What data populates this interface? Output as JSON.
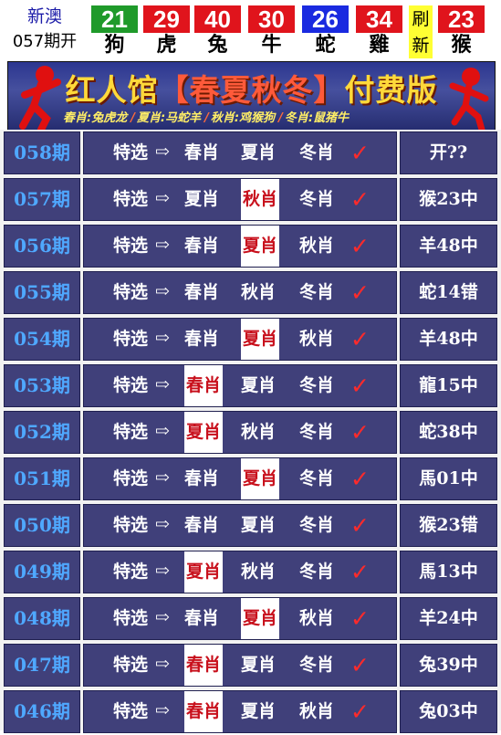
{
  "header": {
    "brand_line1": "新澳",
    "brand_line2": "057期开",
    "balls": [
      {
        "num": "21",
        "zodiac": "狗",
        "color": "#1f9a2a"
      },
      {
        "num": "29",
        "zodiac": "虎",
        "color": "#e0141c"
      },
      {
        "num": "40",
        "zodiac": "兔",
        "color": "#e0141c"
      },
      {
        "num": "30",
        "zodiac": "牛",
        "color": "#e0141c"
      },
      {
        "num": "26",
        "zodiac": "蛇",
        "color": "#1a2ae0"
      },
      {
        "num": "34",
        "zodiac": "雞",
        "color": "#e0141c"
      }
    ],
    "refresh_line1": "刷",
    "refresh_line2": "新",
    "special": {
      "num": "23",
      "zodiac": "猴",
      "color": "#e0141c"
    }
  },
  "banner": {
    "title_a": "红人馆",
    "title_b": "【春夏秋冬】",
    "title_c": "付费版",
    "seasons": [
      "春肖:兔虎龙",
      "夏肖:马蛇羊",
      "秋肖:鸡猴狗",
      "冬肖:鼠猪牛"
    ],
    "separator": "/"
  },
  "rows": [
    {
      "period": "058期",
      "prefix": "特选",
      "arrow": "⇨",
      "picks": [
        "春肖",
        "夏肖",
        "冬肖"
      ],
      "hit": -1,
      "tick": "✓",
      "result": "开??"
    },
    {
      "period": "057期",
      "prefix": "特选",
      "arrow": "⇨",
      "picks": [
        "夏肖",
        "秋肖",
        "冬肖"
      ],
      "hit": 1,
      "tick": "✓",
      "result": "猴23中"
    },
    {
      "period": "056期",
      "prefix": "特选",
      "arrow": "⇨",
      "picks": [
        "春肖",
        "夏肖",
        "秋肖"
      ],
      "hit": 1,
      "tick": "✓",
      "result": "羊48中"
    },
    {
      "period": "055期",
      "prefix": "特选",
      "arrow": "⇨",
      "picks": [
        "春肖",
        "秋肖",
        "冬肖"
      ],
      "hit": -1,
      "tick": "✓",
      "result": "蛇14错"
    },
    {
      "period": "054期",
      "prefix": "特选",
      "arrow": "⇨",
      "picks": [
        "春肖",
        "夏肖",
        "秋肖"
      ],
      "hit": 1,
      "tick": "✓",
      "result": "羊48中"
    },
    {
      "period": "053期",
      "prefix": "特选",
      "arrow": "⇨",
      "picks": [
        "春肖",
        "夏肖",
        "冬肖"
      ],
      "hit": 0,
      "tick": "✓",
      "result": "龍15中"
    },
    {
      "period": "052期",
      "prefix": "特选",
      "arrow": "⇨",
      "picks": [
        "夏肖",
        "秋肖",
        "冬肖"
      ],
      "hit": 0,
      "tick": "✓",
      "result": "蛇38中"
    },
    {
      "period": "051期",
      "prefix": "特选",
      "arrow": "⇨",
      "picks": [
        "春肖",
        "夏肖",
        "冬肖"
      ],
      "hit": 1,
      "tick": "✓",
      "result": "馬01中"
    },
    {
      "period": "050期",
      "prefix": "特选",
      "arrow": "⇨",
      "picks": [
        "春肖",
        "夏肖",
        "冬肖"
      ],
      "hit": -1,
      "tick": "✓",
      "result": "猴23错"
    },
    {
      "period": "049期",
      "prefix": "特选",
      "arrow": "⇨",
      "picks": [
        "夏肖",
        "秋肖",
        "冬肖"
      ],
      "hit": 0,
      "tick": "✓",
      "result": "馬13中"
    },
    {
      "period": "048期",
      "prefix": "特选",
      "arrow": "⇨",
      "picks": [
        "春肖",
        "夏肖",
        "秋肖"
      ],
      "hit": 1,
      "tick": "✓",
      "result": "羊24中"
    },
    {
      "period": "047期",
      "prefix": "特选",
      "arrow": "⇨",
      "picks": [
        "春肖",
        "夏肖",
        "冬肖"
      ],
      "hit": 0,
      "tick": "✓",
      "result": "兔39中"
    },
    {
      "period": "046期",
      "prefix": "特选",
      "arrow": "⇨",
      "picks": [
        "春肖",
        "夏肖",
        "秋肖"
      ],
      "hit": 0,
      "tick": "✓",
      "result": "兔03中"
    }
  ]
}
